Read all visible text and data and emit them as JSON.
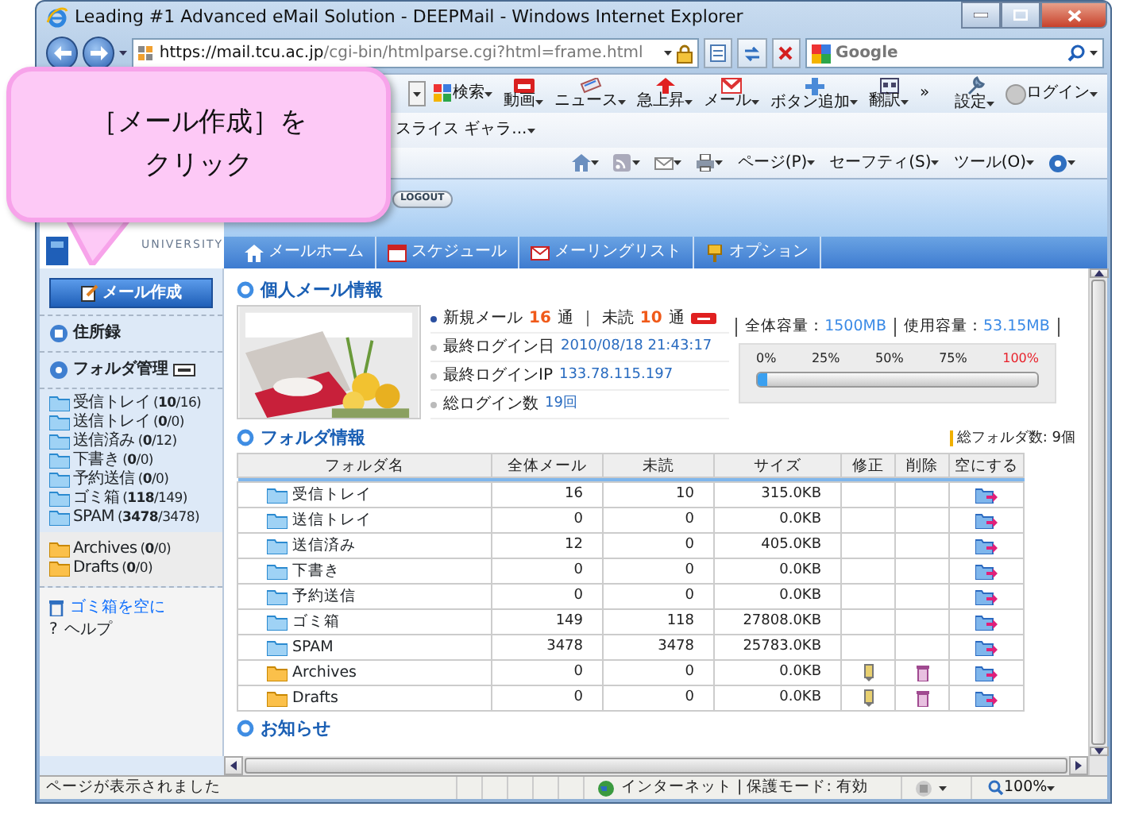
{
  "window": {
    "title": "Leading #1 Advanced eMail Solution - DEEPMail - Windows Internet Explorer"
  },
  "address_bar": {
    "url_host": "https://mail.tcu.ac.jp",
    "url_path": "/cgi-bin/htmlparse.cgi?html=frame.html"
  },
  "search_box": {
    "placeholder": "Google"
  },
  "toolbar": {
    "items": [
      {
        "kind": "search",
        "label": "検索"
      },
      {
        "kind": "video",
        "label": "動画"
      },
      {
        "kind": "news",
        "label": "ニュース"
      },
      {
        "kind": "trend",
        "label": "急上昇"
      },
      {
        "kind": "mail",
        "label": "メール"
      },
      {
        "kind": "add",
        "label": "ボタン追加"
      },
      {
        "kind": "translate",
        "label": "翻訳"
      },
      {
        "kind": "more",
        "label": "»"
      },
      {
        "kind": "settings",
        "label": "設定"
      },
      {
        "kind": "login",
        "label": "ログイン"
      }
    ]
  },
  "favorites_bar": {
    "item": "スライス ギャラ..."
  },
  "command_bar": {
    "menus": [
      "ページ(P)",
      "セーフティ(S)",
      "ツール(O)"
    ]
  },
  "header": {
    "logo_text": "UNIVERSITY",
    "logout": "LOGOUT",
    "tabs": [
      {
        "kind": "home",
        "label": "メールホーム"
      },
      {
        "kind": "schedule",
        "label": "スケジュール"
      },
      {
        "kind": "mailing_list",
        "label": "メーリングリスト"
      },
      {
        "kind": "options",
        "label": "オプション"
      }
    ]
  },
  "sidebar": {
    "compose": "メール作成",
    "links": [
      {
        "kind": "address_book",
        "label": "住所録"
      },
      {
        "kind": "folder_manage",
        "label": "フォルダ管理"
      }
    ],
    "folders": [
      {
        "kind": "system",
        "name": "受信トレイ",
        "counts": "(**10**/16)"
      },
      {
        "kind": "system",
        "name": "送信トレイ",
        "counts": "(**0**/0)"
      },
      {
        "kind": "system",
        "name": "送信済み",
        "counts": "(**0**/12)"
      },
      {
        "kind": "system",
        "name": "下書き",
        "counts": "(**0**/0)"
      },
      {
        "kind": "system",
        "name": "予約送信",
        "counts": "(**0**/0)"
      },
      {
        "kind": "system",
        "name": "ゴミ箱",
        "counts": "(**118**/149)"
      },
      {
        "kind": "system",
        "name": "SPAM",
        "counts": "(**3478**/3478)"
      },
      {
        "kind": "custom",
        "name": "Archives",
        "counts": "(**0**/0)"
      },
      {
        "kind": "custom",
        "name": "Drafts",
        "counts": "(**0**/0)"
      }
    ],
    "actions": [
      {
        "kind": "empty_trash",
        "label": "ゴミ箱を空に"
      },
      {
        "kind": "help",
        "glyph": "?",
        "label": "ヘルプ"
      }
    ]
  },
  "personal_info": {
    "title": "個人メール情報",
    "rows": [
      {
        "kind": "counts",
        "parts": [
          {
            "text": "新規メール",
            "accent": false
          },
          {
            "text": "16",
            "accent": true
          },
          {
            "text": "通",
            "accent": false
          },
          {
            "text": "｜",
            "accent": false
          },
          {
            "text": "未読",
            "accent": false
          },
          {
            "text": "10",
            "accent": true
          },
          {
            "text": "通",
            "accent": false
          }
        ]
      },
      {
        "kind": "plain",
        "label": "最終ログイン日",
        "value": "2010/08/18 21:43:17"
      },
      {
        "kind": "plain",
        "label": "最終ログインIP",
        "value": "133.78.115.197"
      },
      {
        "kind": "plain",
        "label": "総ログイン数",
        "value": "19回"
      }
    ],
    "quota": {
      "total_label": "全体容量：",
      "total": "1500MB",
      "used_label": "使用容量：",
      "used": "53.15MB",
      "level": 0.035,
      "ticks": [
        {
          "label": "0%",
          "color": "#222222"
        },
        {
          "label": "25%",
          "color": "#222222"
        },
        {
          "label": "50%",
          "color": "#222222"
        },
        {
          "label": "75%",
          "color": "#222222"
        },
        {
          "label": "100%",
          "color": "#e8202a"
        }
      ]
    }
  },
  "folder_info": {
    "title": "フォルダ情報",
    "folder_count": "総フォルダ数: 9個",
    "columns": [
      "フォルダ名",
      "全体メール",
      "未読",
      "サイズ",
      "修正",
      "削除",
      "空にする"
    ],
    "rows": [
      {
        "kind": "system",
        "name": "受信トレイ",
        "total": "16",
        "unread": "10",
        "size": "315.0KB"
      },
      {
        "kind": "system",
        "name": "送信トレイ",
        "total": "0",
        "unread": "0",
        "size": "0.0KB"
      },
      {
        "kind": "system",
        "name": "送信済み",
        "total": "12",
        "unread": "0",
        "size": "405.0KB"
      },
      {
        "kind": "system",
        "name": "下書き",
        "total": "0",
        "unread": "0",
        "size": "0.0KB"
      },
      {
        "kind": "system",
        "name": "予約送信",
        "total": "0",
        "unread": "0",
        "size": "0.0KB"
      },
      {
        "kind": "system",
        "name": "ゴミ箱",
        "total": "149",
        "unread": "118",
        "size": "27808.0KB"
      },
      {
        "kind": "system",
        "name": "SPAM",
        "total": "3478",
        "unread": "3478",
        "size": "25783.0KB"
      },
      {
        "kind": "custom",
        "name": "Archives",
        "total": "0",
        "unread": "0",
        "size": "0.0KB"
      },
      {
        "kind": "custom",
        "name": "Drafts",
        "total": "0",
        "unread": "0",
        "size": "0.0KB"
      }
    ]
  },
  "notice": {
    "title": "お知らせ"
  },
  "status_bar": {
    "message": "ページが表示されました",
    "zone": "インターネット | 保護モード: 有効",
    "zoom": "100%"
  },
  "callout": {
    "lines": [
      "［メール作成］を",
      "クリック"
    ]
  }
}
